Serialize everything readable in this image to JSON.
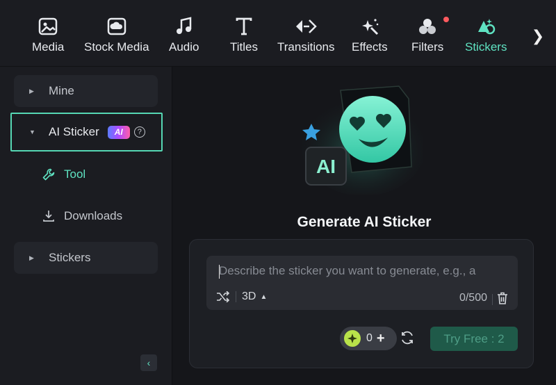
{
  "toolbar": {
    "items": [
      {
        "label": "Media",
        "icon": "media-icon"
      },
      {
        "label": "Stock Media",
        "icon": "stock-media-icon"
      },
      {
        "label": "Audio",
        "icon": "audio-icon"
      },
      {
        "label": "Titles",
        "icon": "titles-icon"
      },
      {
        "label": "Transitions",
        "icon": "transitions-icon"
      },
      {
        "label": "Effects",
        "icon": "effects-icon"
      },
      {
        "label": "Filters",
        "icon": "filters-icon"
      },
      {
        "label": "Stickers",
        "icon": "stickers-icon"
      }
    ],
    "active": "Stickers",
    "more_glyph": "❯"
  },
  "sidebar": {
    "mine": "Mine",
    "ai_sticker": "AI Sticker",
    "ai_badge": "AI",
    "help_glyph": "?",
    "tool": "Tool",
    "downloads": "Downloads",
    "stickers": "Stickers",
    "collapse_glyph": "‹"
  },
  "main": {
    "hero_badge": "AI",
    "title": "Generate AI Sticker",
    "prompt_placeholder": "Describe the sticker you want to generate, e.g., a",
    "style": "3D",
    "char_count": "0/500",
    "credits": "0",
    "try_button": "Try Free : 2"
  },
  "colors": {
    "accent": "#5fe3c2",
    "highlight_border": "#56d8b4",
    "try_button_bg": "#1f5a49",
    "background": "#15161a"
  }
}
